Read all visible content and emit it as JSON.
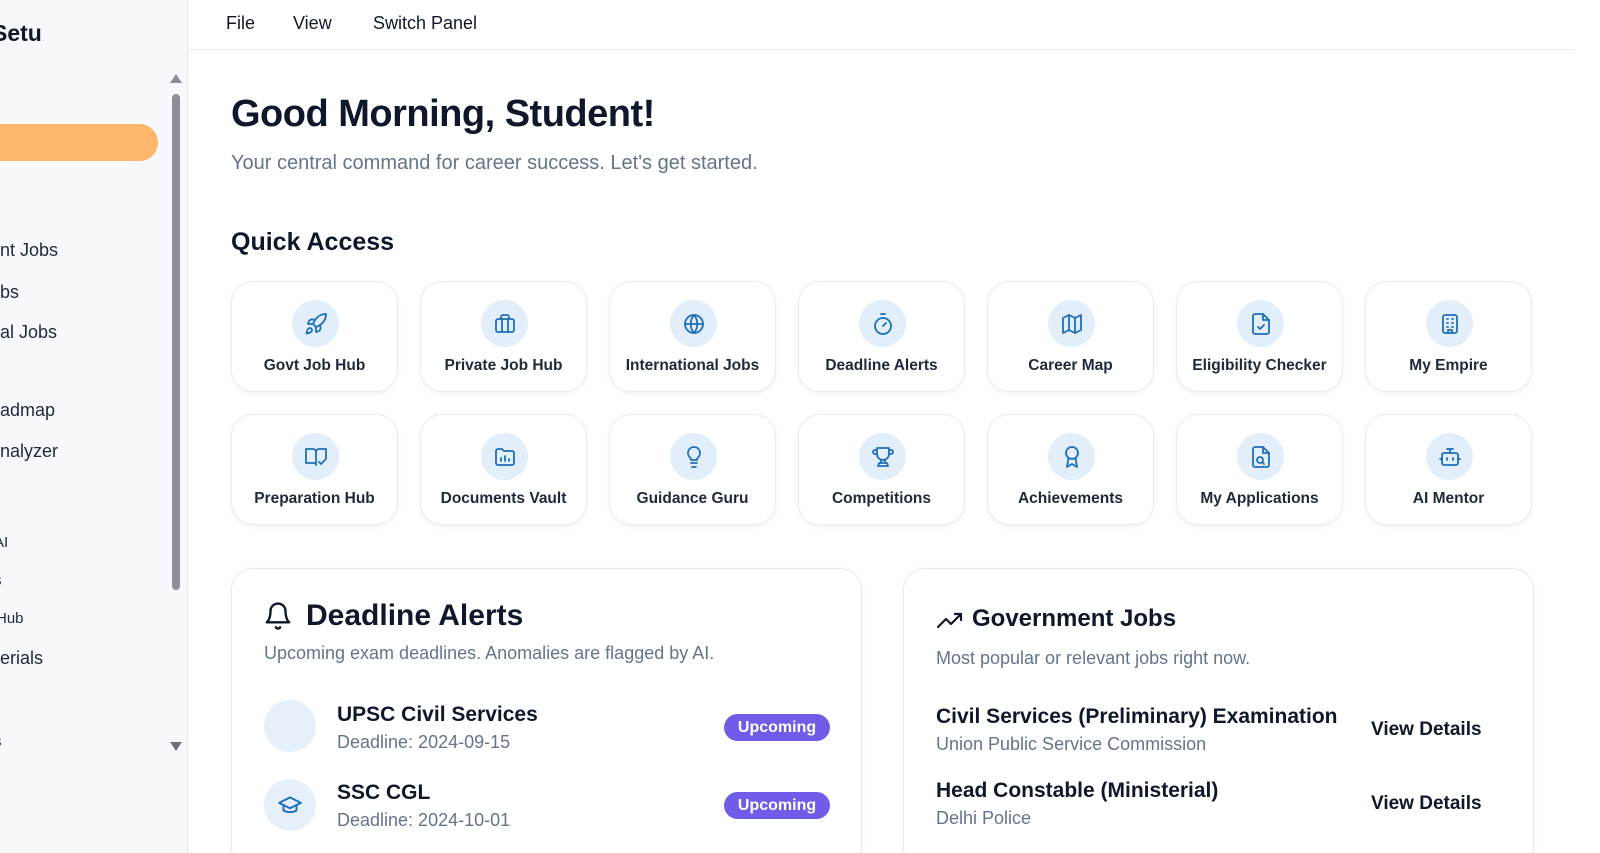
{
  "sidebar": {
    "brand": "Setu",
    "items": [
      {
        "label": "nt Jobs"
      },
      {
        "label": "bs"
      },
      {
        "label": "al Jobs"
      },
      {
        "label": "admap"
      },
      {
        "label": "nalyzer"
      },
      {
        "label": "AI"
      },
      {
        "label": "s"
      },
      {
        "label": "Hub"
      },
      {
        "label": "erials"
      },
      {
        "label": "s"
      }
    ]
  },
  "menubar": {
    "file": "File",
    "view": "View",
    "switch_panel": "Switch Panel"
  },
  "header": {
    "greeting": "Good Morning, Student!",
    "subtitle": "Your central command for career success. Let's get started."
  },
  "quick_access": {
    "title": "Quick Access",
    "tiles": [
      {
        "label": "Govt Job Hub",
        "icon": "rocket-icon"
      },
      {
        "label": "Private Job Hub",
        "icon": "briefcase-icon"
      },
      {
        "label": "International Jobs",
        "icon": "globe-icon"
      },
      {
        "label": "Deadline Alerts",
        "icon": "timer-icon"
      },
      {
        "label": "Career Map",
        "icon": "map-icon"
      },
      {
        "label": "Eligibility Checker",
        "icon": "file-check-icon"
      },
      {
        "label": "My Empire",
        "icon": "building-icon"
      },
      {
        "label": "Preparation Hub",
        "icon": "book-check-icon"
      },
      {
        "label": "Documents Vault",
        "icon": "folder-chart-icon"
      },
      {
        "label": "Guidance Guru",
        "icon": "lightbulb-icon"
      },
      {
        "label": "Competitions",
        "icon": "trophy-icon"
      },
      {
        "label": "Achievements",
        "icon": "award-icon"
      },
      {
        "label": "My Applications",
        "icon": "file-search-icon"
      },
      {
        "label": "AI Mentor",
        "icon": "bot-icon"
      }
    ]
  },
  "deadline_alerts": {
    "title": "Deadline Alerts",
    "subtitle": "Upcoming exam deadlines. Anomalies are flagged by AI.",
    "items": [
      {
        "name": "UPSC Civil Services",
        "deadline": "Deadline: 2024-09-15",
        "status": "Upcoming"
      },
      {
        "name": "SSC CGL",
        "deadline": "Deadline: 2024-10-01",
        "status": "Upcoming"
      }
    ]
  },
  "government_jobs": {
    "title": "Government Jobs",
    "subtitle": "Most popular or relevant jobs right now.",
    "items": [
      {
        "name": "Civil Services (Preliminary) Examination",
        "org": "Union Public Service Commission",
        "action": "View Details"
      },
      {
        "name": "Head Constable (Ministerial)",
        "org": "Delhi Police",
        "action": "View Details"
      }
    ]
  },
  "colors": {
    "accent_orange": "#fdb76c",
    "badge_purple": "#6f5ce8",
    "icon_blue": "#1d6fb8",
    "icon_bg": "#e3eefb"
  }
}
